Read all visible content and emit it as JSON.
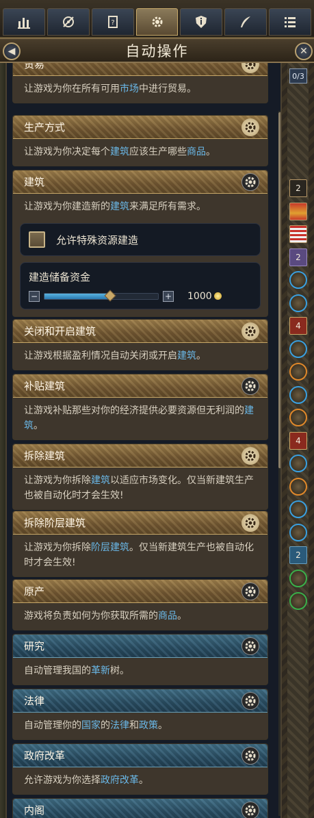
{
  "tabs": [
    {
      "name": "tab-economy",
      "icon": "bar-chart-icon"
    },
    {
      "name": "tab-diplomacy",
      "icon": "compass-icon"
    },
    {
      "name": "tab-journal",
      "icon": "scroll-icon"
    },
    {
      "name": "tab-automation",
      "icon": "gear-icon",
      "active": true
    },
    {
      "name": "tab-info",
      "icon": "info-shield-icon"
    },
    {
      "name": "tab-decisions",
      "icon": "quill-icon"
    },
    {
      "name": "tab-list",
      "icon": "list-icon"
    }
  ],
  "title": "自动操作",
  "page_indicator": "0/3",
  "cards": {
    "trade": {
      "title": "贸易",
      "desc_a": "让游戏为你在所有可用",
      "desc_hl1": "市场",
      "desc_b": "中进行贸易。"
    },
    "production": {
      "title": "生产方式",
      "desc_a": "让游戏为你决定每个",
      "desc_hl1": "建筑",
      "desc_b": "应该生产哪些",
      "desc_hl2": "商品",
      "desc_c": "。"
    },
    "construction": {
      "title": "建筑",
      "desc_a": "让游戏为你建造新的",
      "desc_hl1": "建筑",
      "desc_b": "来满足所有需求。",
      "checkbox_label": "允许特殊资源建造",
      "checkbox_checked": false,
      "reserve_label": "建造储备资金",
      "reserve_amount": "1000",
      "reserve_fill_fraction": 0.58
    },
    "toggle": {
      "title": "关闭和开启建筑",
      "desc_a": "让游戏根据盈利情况自动关闭或开启",
      "desc_hl1": "建筑",
      "desc_b": "。"
    },
    "subsidize": {
      "title": "补贴建筑",
      "desc_a": "让游戏补贴那些对你的经济提供必要资源但无利润的",
      "desc_hl1": "建筑",
      "desc_b": "。"
    },
    "demolish": {
      "title": "拆除建筑",
      "desc_a": "让游戏为你拆除",
      "desc_hl1": "建筑",
      "desc_b": "以适应市场变化。仅当新建筑生产也被自动化时才会生效!"
    },
    "demolish_level": {
      "title": "拆除阶层建筑",
      "desc_a": "让游戏为你拆除",
      "desc_hl1": "阶层建筑",
      "desc_b": "。仅当新建筑生产也被自动化时才会生效!"
    },
    "raw": {
      "title": "原产",
      "desc_a": "游戏将负责如何为你获取所需的",
      "desc_hl1": "商品",
      "desc_b": "。"
    },
    "research": {
      "title": "研究",
      "desc_a": "自动管理我国的",
      "desc_hl1": "革新",
      "desc_b": "树。"
    },
    "law": {
      "title": "法律",
      "desc_a": "自动管理你的",
      "desc_hl1": "国家",
      "desc_b": "的",
      "desc_hl2": "法律",
      "desc_c": "和",
      "desc_hl3": "政策",
      "desc_d": "。"
    },
    "reform": {
      "title": "政府改革",
      "desc_a": "允许游戏为你选择",
      "desc_hl1": "政府改革",
      "desc_b": "。"
    },
    "cabinet": {
      "title": "内阁"
    }
  },
  "sidebar": [
    {
      "type": "num",
      "value": "2",
      "style": "dark"
    },
    {
      "type": "flag",
      "icon": "red-flag-icon"
    },
    {
      "type": "flag",
      "icon": "striped-flag-icon"
    },
    {
      "type": "num",
      "value": "2",
      "style": "purple"
    },
    {
      "type": "circle",
      "icon": "globe-arrow-icon"
    },
    {
      "type": "circle",
      "icon": "globe-arrow-icon"
    },
    {
      "type": "num",
      "value": "4",
      "style": "red"
    },
    {
      "type": "circle",
      "icon": "plant-icon"
    },
    {
      "type": "circle",
      "icon": "rope-icon"
    },
    {
      "type": "circle",
      "icon": "chest-icon"
    },
    {
      "type": "circle",
      "icon": "sack-icon"
    },
    {
      "type": "num",
      "value": "4",
      "style": "red"
    },
    {
      "type": "circle",
      "icon": "tools-icon"
    },
    {
      "type": "circle",
      "icon": "furnace-icon"
    },
    {
      "type": "circle",
      "icon": "building-icon"
    },
    {
      "type": "circle",
      "icon": "ship-icon"
    },
    {
      "type": "num",
      "value": "2",
      "style": "blue"
    },
    {
      "type": "circle",
      "icon": "handshake-icon"
    },
    {
      "type": "circle",
      "icon": "handshake-icon"
    }
  ],
  "colors": {
    "highlight": "#6ab8e8",
    "gold_header": "#8a6c3c",
    "blue_header": "#2e5468"
  }
}
